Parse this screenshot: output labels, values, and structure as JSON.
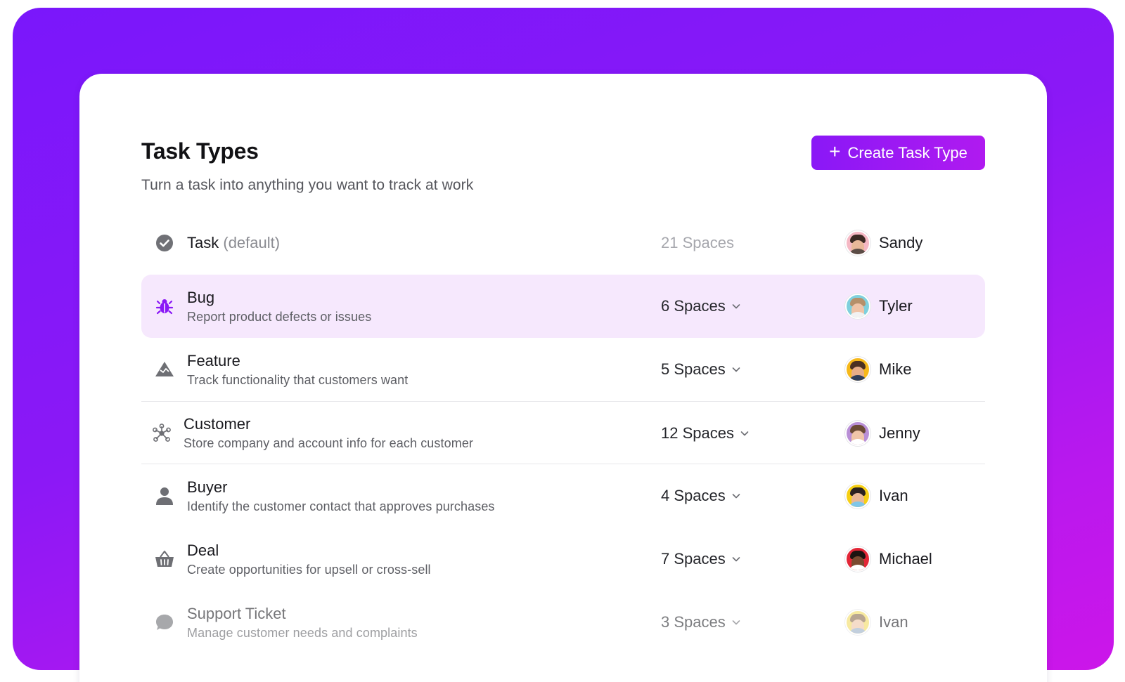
{
  "header": {
    "title": "Task Types",
    "subtitle": "Turn a task into anything you want to track at work",
    "create_button_label": "Create Task Type",
    "create_button_icon": "plus-icon"
  },
  "colors": {
    "accent": "#8a18f6",
    "frame_gradient_start": "#7a17fb",
    "frame_gradient_end": "#cc16e9",
    "active_row_bg": "#f6e8fd"
  },
  "rows": [
    {
      "name": "Task",
      "name_suffix": "(default)",
      "description": "",
      "icon": "check-circle-icon",
      "spaces": "21 Spaces",
      "owner": "Sandy",
      "avatar_bg": "#f5b8c4"
    },
    {
      "name": "Bug",
      "description": "Report product defects or issues",
      "icon": "bug-icon",
      "spaces": "6 Spaces",
      "owner": "Tyler",
      "avatar_bg": "#7fd0dd"
    },
    {
      "name": "Feature",
      "description": "Track functionality that customers want",
      "icon": "mountain-icon",
      "spaces": "5 Spaces",
      "owner": "Mike",
      "avatar_bg": "#f6b81a"
    },
    {
      "name": "Customer",
      "description": "Store company and account info for each customer",
      "icon": "network-icon",
      "spaces": "12 Spaces",
      "owner": "Jenny",
      "avatar_bg": "#b98fd6"
    },
    {
      "name": "Buyer",
      "description": "Identify the customer contact that approves purchases",
      "icon": "person-icon",
      "spaces": "4 Spaces",
      "owner": "Ivan",
      "avatar_bg": "#f6cf14"
    },
    {
      "name": "Deal",
      "description": "Create opportunities for upsell or cross-sell",
      "icon": "basket-icon",
      "spaces": "7 Spaces",
      "owner": "Michael",
      "avatar_bg": "#e32637"
    },
    {
      "name": "Support Ticket",
      "description": "Manage customer needs and complaints",
      "icon": "chat-bubble-icon",
      "spaces": "3 Spaces",
      "owner": "Ivan",
      "avatar_bg": "#f3dc62"
    }
  ]
}
